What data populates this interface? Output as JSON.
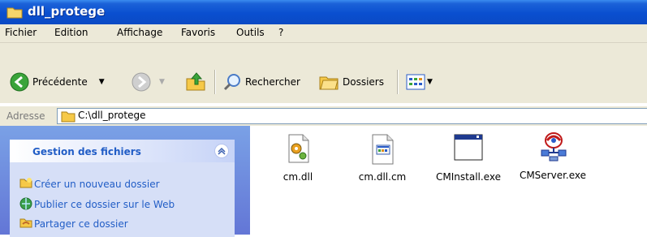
{
  "window": {
    "title": "dll_protege"
  },
  "menu": {
    "items": [
      "Fichier",
      "Edition",
      "Affichage",
      "Favoris",
      "Outils",
      "?"
    ]
  },
  "toolbar": {
    "back_label": "Précédente",
    "search_label": "Rechercher",
    "folders_label": "Dossiers"
  },
  "address": {
    "label": "Adresse",
    "path": "C:\\dll_protege"
  },
  "tasks": {
    "header": "Gestion des fichiers",
    "links": [
      "Créer un nouveau dossier",
      "Publier ce dossier sur le Web",
      "Partager ce dossier"
    ]
  },
  "files": [
    {
      "name": "cm.dll",
      "icon": "dll-gear-icon"
    },
    {
      "name": "cm.dll.cm",
      "icon": "file-icon"
    },
    {
      "name": "CMInstall.exe",
      "icon": "application-window-icon"
    },
    {
      "name": "CMServer.exe",
      "icon": "network-server-icon"
    }
  ],
  "colors": {
    "titlebar": "#0a4fd0",
    "task_link": "#215dc6",
    "chrome": "#ece9d8"
  }
}
